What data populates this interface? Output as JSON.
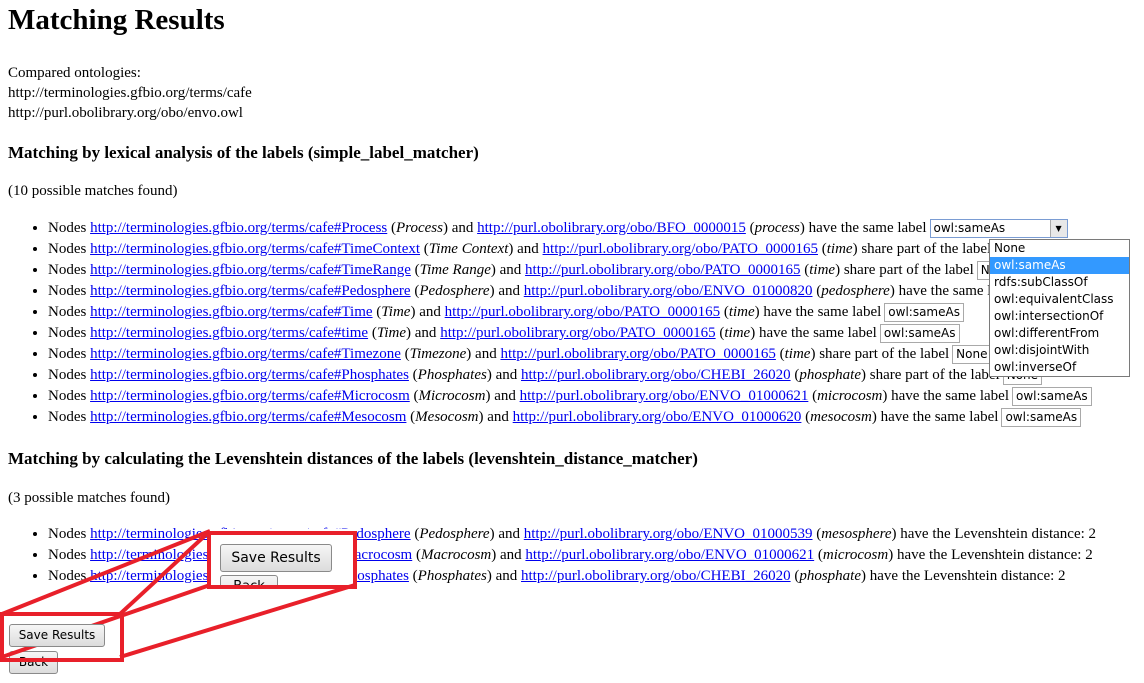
{
  "title": "Matching Results",
  "ontologies": {
    "label": "Compared ontologies:",
    "items": [
      "http://terminologies.gfbio.org/terms/cafe",
      "http://purl.obolibrary.org/obo/envo.owl"
    ]
  },
  "sections": [
    {
      "heading": "Matching by lexical analysis of the labels (simple_label_matcher)",
      "count": "(10 possible matches found)",
      "rows": [
        {
          "a": "http://terminologies.gfbio.org/terms/cafe#Process",
          "al": "Process",
          "b": "http://purl.obolibrary.org/obo/BFO_0000015",
          "bl": "process",
          "rel": "have the same label",
          "sel": "owl:sameAs"
        },
        {
          "a": "http://terminologies.gfbio.org/terms/cafe#TimeContext",
          "al": "Time Context",
          "b": "http://purl.obolibrary.org/obo/PATO_0000165",
          "bl": "time",
          "rel": "share part of the label",
          "sel": "None"
        },
        {
          "a": "http://terminologies.gfbio.org/terms/cafe#TimeRange",
          "al": "Time Range",
          "b": "http://purl.obolibrary.org/obo/PATO_0000165",
          "bl": "time",
          "rel": "share part of the label",
          "sel": "None"
        },
        {
          "a": "http://terminologies.gfbio.org/terms/cafe#Pedosphere",
          "al": "Pedosphere",
          "b": "http://purl.obolibrary.org/obo/ENVO_01000820",
          "bl": "pedosphere",
          "rel": "have the same label",
          "sel": "owl:sameAs"
        },
        {
          "a": "http://terminologies.gfbio.org/terms/cafe#Time",
          "al": "Time",
          "b": "http://purl.obolibrary.org/obo/PATO_0000165",
          "bl": "time",
          "rel": "have the same label",
          "sel": "owl:sameAs"
        },
        {
          "a": "http://terminologies.gfbio.org/terms/cafe#time",
          "al": "Time",
          "b": "http://purl.obolibrary.org/obo/PATO_0000165",
          "bl": "time",
          "rel": "have the same label",
          "sel": "owl:sameAs"
        },
        {
          "a": "http://terminologies.gfbio.org/terms/cafe#Timezone",
          "al": "Timezone",
          "b": "http://purl.obolibrary.org/obo/PATO_0000165",
          "bl": "time",
          "rel": "share part of the label",
          "sel": "None"
        },
        {
          "a": "http://terminologies.gfbio.org/terms/cafe#Phosphates",
          "al": "Phosphates",
          "b": "http://purl.obolibrary.org/obo/CHEBI_26020",
          "bl": "phosphate",
          "rel": "share part of the label",
          "sel": "None"
        },
        {
          "a": "http://terminologies.gfbio.org/terms/cafe#Microcosm",
          "al": "Microcosm",
          "b": "http://purl.obolibrary.org/obo/ENVO_01000621",
          "bl": "microcosm",
          "rel": "have the same label",
          "sel": "owl:sameAs"
        },
        {
          "a": "http://terminologies.gfbio.org/terms/cafe#Mesocosm",
          "al": "Mesocosm",
          "b": "http://purl.obolibrary.org/obo/ENVO_01000620",
          "bl": "mesocosm",
          "rel": "have the same label",
          "sel": "owl:sameAs"
        }
      ]
    },
    {
      "heading": "Matching by calculating the Levenshtein distances of the labels (levenshtein_distance_matcher)",
      "count": "(3 possible matches found)",
      "rows": [
        {
          "a": "http://terminologies.gfbio.org/terms/cafe#Pedosphere",
          "al": "Pedosphere",
          "b": "http://purl.obolibrary.org/obo/ENVO_01000539",
          "bl": "mesosphere",
          "rel": "have the Levenshtein distance: 2",
          "sel": ""
        },
        {
          "a": "http://terminologies.gfbio.org/terms/cafe#Macrocosm",
          "al": "Macrocosm",
          "b": "http://purl.obolibrary.org/obo/ENVO_01000621",
          "bl": "microcosm",
          "rel": "have the Levenshtein distance: 2",
          "sel": ""
        },
        {
          "a": "http://terminologies.gfbio.org/terms/cafe#Phosphates",
          "al": "Phosphates",
          "b": "http://purl.obolibrary.org/obo/CHEBI_26020",
          "bl": "phosphate",
          "rel": "have the Levenshtein distance: 2",
          "sel": ""
        }
      ]
    }
  ],
  "words": {
    "nodes": "Nodes",
    "and": "and"
  },
  "dropdown_options": [
    "None",
    "owl:sameAs",
    "rdfs:subClassOf",
    "owl:equivalentClass",
    "owl:intersectionOf",
    "owl:differentFrom",
    "owl:disjointWith",
    "owl:inverseOf"
  ],
  "dropdown_highlighted": "owl:sameAs",
  "buttons": {
    "save": "Save Results",
    "back": "Back"
  },
  "zoom_fragment": {
    "back_partial": "Back"
  },
  "colors": {
    "highlight": "#e8202a",
    "link": "#0000ee",
    "selected_option": "#3399ff"
  }
}
